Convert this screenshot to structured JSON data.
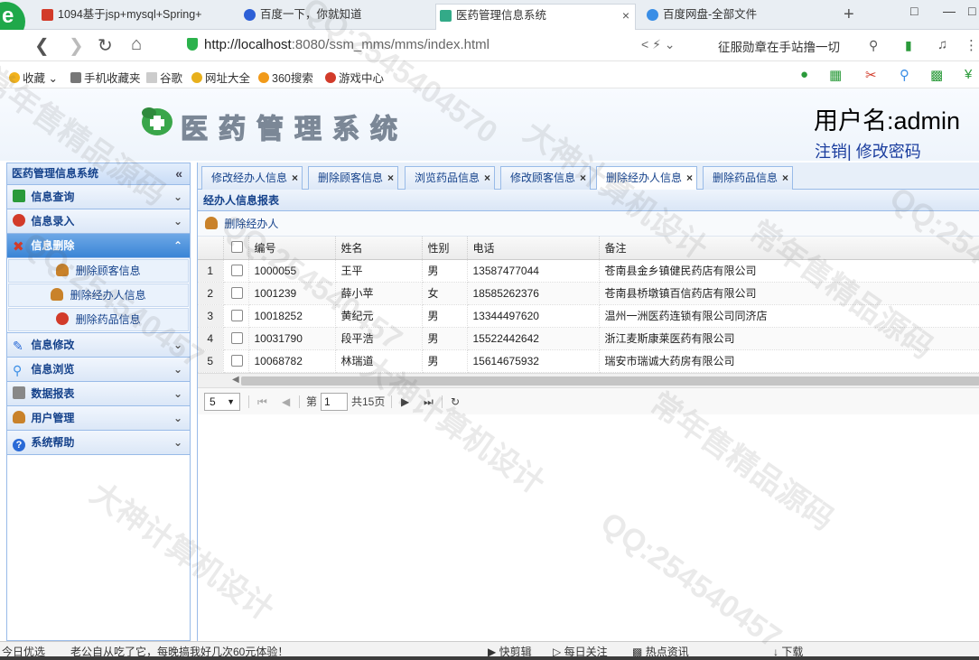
{
  "browser": {
    "tabs": [
      {
        "title": "1094基于jsp+mysql+Spring+",
        "color": "#d23b2a"
      },
      {
        "title": "百度一下，你就知道",
        "color": "#2c5fd6"
      },
      {
        "title": "医药管理信息系统",
        "color": "#33aa88"
      },
      {
        "title": "百度网盘-全部文件",
        "color": "#3a8ee6"
      }
    ],
    "close_glyph": "×",
    "new_tab_glyph": "+",
    "url_host": "http://localhost",
    "url_rest": ":8080/ssm_mms/mms/index.html",
    "search_hint": "征服勋章在手站撸一切",
    "bookmarks": [
      "收藏",
      "手机收藏夹",
      "谷歌",
      "网址大全",
      "360搜索",
      "游戏中心"
    ]
  },
  "header": {
    "logo_text": "医药管理系统",
    "user_label": "用户名:admin",
    "logout": "注销",
    "link_sep": "|",
    "change_password": "修改密码"
  },
  "sidebar": {
    "title": "医药管理信息系统",
    "collapse_glyph": "«",
    "sections": [
      {
        "label": "信息查询",
        "icon": "card-icon",
        "color": "#2a9a3a"
      },
      {
        "label": "信息录入",
        "icon": "no-entry-icon",
        "color": "#d23b2a"
      },
      {
        "label": "信息删除",
        "icon": "delete-x-icon",
        "color": "#d23b2a"
      },
      {
        "label": "信息修改",
        "icon": "pencil-icon",
        "color": "#2a6ad6"
      },
      {
        "label": "信息浏览",
        "icon": "magnifier-icon",
        "color": "#3a8ee6"
      },
      {
        "label": "数据报表",
        "icon": "printer-icon",
        "color": "#666666"
      },
      {
        "label": "用户管理",
        "icon": "user-icon",
        "color": "#c9822a"
      },
      {
        "label": "系统帮助",
        "icon": "help-icon",
        "color": "#2a6ad6"
      }
    ],
    "delete_items": [
      "删除顾客信息",
      "删除经办人信息",
      "删除药品信息"
    ]
  },
  "main": {
    "tabs": [
      "修改经办人信息",
      "删除顾客信息",
      "浏览药品信息",
      "修改顾客信息",
      "删除经办人信息",
      "删除药品信息"
    ],
    "active_tab": 4,
    "tab_close_glyph": "×",
    "panel_title": "经办人信息报表",
    "toolbar_button": "删除经办人",
    "columns": [
      "编号",
      "姓名",
      "性别",
      "电话",
      "备注"
    ],
    "rows": [
      [
        "1",
        "1000055",
        "王平",
        "男",
        "13587477044",
        "苍南县金乡镇健民药店有限公司"
      ],
      [
        "2",
        "1001239",
        "薛小苹",
        "女",
        "18585262376",
        "苍南县桥墩镇百信药店有限公司"
      ],
      [
        "3",
        "10018252",
        "黄纪元",
        "男",
        "13344497620",
        "温州一洲医药连锁有限公司同济店"
      ],
      [
        "4",
        "10031790",
        "段平浩",
        "男",
        "15522442642",
        "浙江麦斯康莱医药有限公司"
      ],
      [
        "5",
        "10068782",
        "林瑞道",
        "男",
        "15614675932",
        "瑞安市瑞诚大药房有限公司"
      ]
    ],
    "pager": {
      "page_size": "5",
      "page_prefix": "第",
      "page": "1",
      "total_text": "共15页"
    }
  },
  "statusbar": {
    "left": "今日优选",
    "news": "老公自从吃了它，每晚搞我好几次60元体验！",
    "items": [
      "快剪辑",
      "每日关注",
      "热点资讯",
      "下载"
    ]
  },
  "watermarks": [
    "QQ:2545404570",
    "大神计算机设计",
    "常年售精品源码",
    "QQ:254540457",
    "大神计算机设计",
    "常年售精品源码",
    "QQ:254540457",
    "大神计算机设计",
    "QQ:254540457",
    "常年售精品源码",
    "QQ:254540457"
  ]
}
